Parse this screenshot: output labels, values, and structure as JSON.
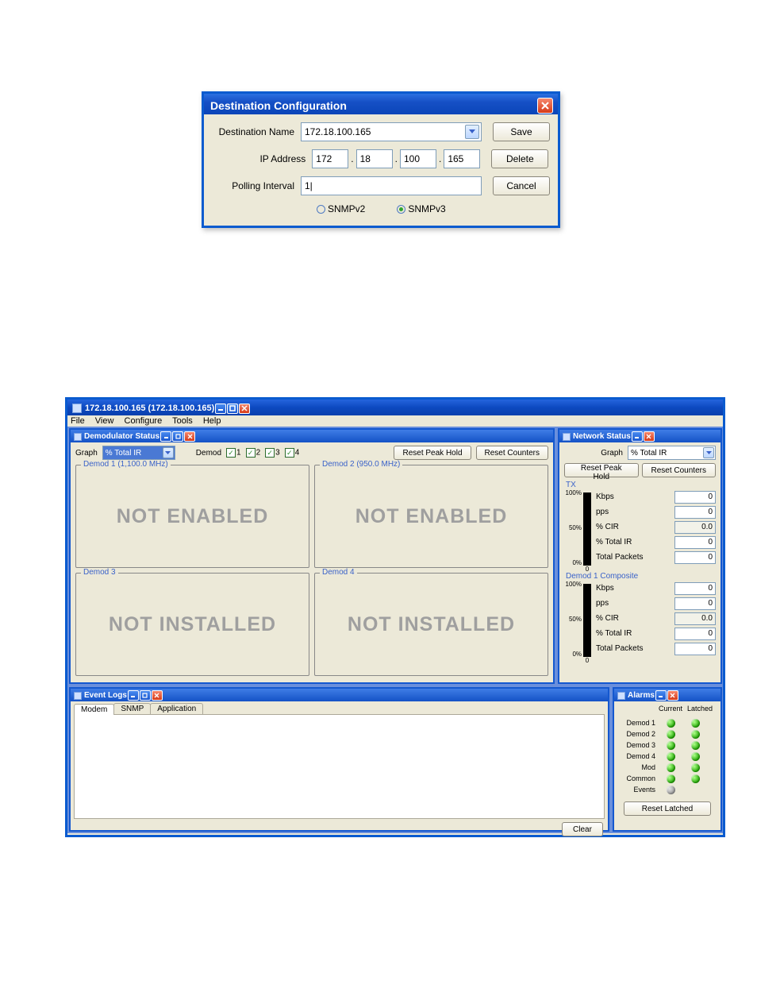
{
  "dest_config": {
    "title": "Destination Configuration",
    "labels": {
      "name": "Destination Name",
      "ip": "IP Address",
      "poll": "Polling Interval"
    },
    "name_value": "172.18.100.165",
    "ip": {
      "o1": "172",
      "o2": "18",
      "o3": "100",
      "o4": "165"
    },
    "poll_value": "1|",
    "buttons": {
      "save": "Save",
      "delete": "Delete",
      "cancel": "Cancel"
    },
    "snmp": {
      "v2": "SNMPv2",
      "v3": "SNMPv3",
      "selected": "v3"
    }
  },
  "app": {
    "title": "172.18.100.165 (172.18.100.165)",
    "menu": {
      "file": "File",
      "view": "View",
      "configure": "Configure",
      "tools": "Tools",
      "help": "Help"
    }
  },
  "demod": {
    "title": "Demodulator Status",
    "graph_label": "Graph",
    "graph_value": "% Total IR",
    "demod_label": "Demod",
    "checks": {
      "c1": "1",
      "c2": "2",
      "c3": "3",
      "c4": "4"
    },
    "buttons": {
      "reset_peak": "Reset Peak Hold",
      "reset_counters": "Reset Counters"
    },
    "panels": {
      "p1": {
        "legend": "Demod 1 (1,100.0 MHz)",
        "text": "NOT ENABLED"
      },
      "p2": {
        "legend": "Demod 2 (950.0 MHz)",
        "text": "NOT ENABLED"
      },
      "p3": {
        "legend": "Demod 3",
        "text": "NOT INSTALLED"
      },
      "p4": {
        "legend": "Demod 4",
        "text": "NOT INSTALLED"
      }
    }
  },
  "net": {
    "title": "Network Status",
    "graph_label": "Graph",
    "graph_value": "% Total IR",
    "buttons": {
      "reset_peak": "Reset Peak Hold",
      "reset_counters": "Reset Counters"
    },
    "scale": {
      "p100": "100%",
      "p50": "50%",
      "p0": "0%",
      "zero": "0"
    },
    "sections": {
      "tx": {
        "title": "TX",
        "metrics": {
          "kbps": {
            "label": "Kbps",
            "value": "0"
          },
          "pps": {
            "label": "pps",
            "value": "0"
          },
          "cir": {
            "label": "% CIR",
            "value": "0.0"
          },
          "totalir": {
            "label": "% Total IR",
            "value": "0"
          },
          "totalpkt": {
            "label": "Total Packets",
            "value": "0"
          }
        }
      },
      "d1": {
        "title": "Demod 1 Composite",
        "metrics": {
          "kbps": {
            "label": "Kbps",
            "value": "0"
          },
          "pps": {
            "label": "pps",
            "value": "0"
          },
          "cir": {
            "label": "% CIR",
            "value": "0.0"
          },
          "totalir": {
            "label": "% Total IR",
            "value": "0"
          },
          "totalpkt": {
            "label": "Total Packets",
            "value": "0"
          }
        }
      }
    }
  },
  "logs": {
    "title": "Event Logs",
    "tabs": {
      "modem": "Modem",
      "snmp": "SNMP",
      "app": "Application"
    },
    "clear": "Clear"
  },
  "alarms": {
    "title": "Alarms",
    "columns": {
      "current": "Current",
      "latched": "Latched"
    },
    "rows": {
      "d1": "Demod 1",
      "d2": "Demod 2",
      "d3": "Demod 3",
      "d4": "Demod 4",
      "mod": "Mod",
      "common": "Common",
      "events": "Events"
    },
    "reset": "Reset Latched"
  }
}
